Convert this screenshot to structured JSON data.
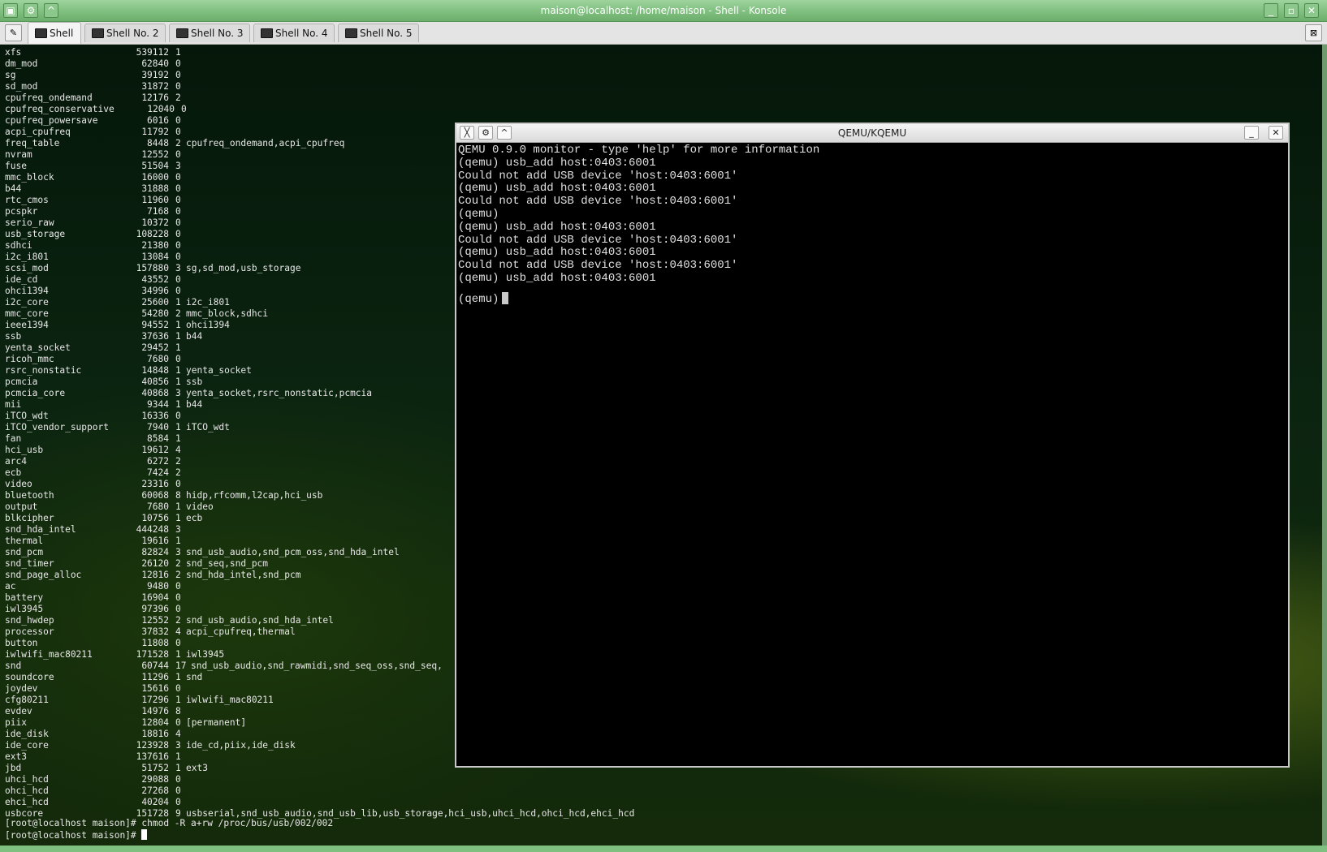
{
  "konsole": {
    "title": "maison@localhost: /home/maison - Shell - Konsole",
    "tabs": [
      "Shell",
      "Shell No. 2",
      "Shell No. 3",
      "Shell No. 4",
      "Shell No. 5"
    ],
    "active_tab": 0,
    "modules": [
      [
        "xfs",
        "539112",
        "1",
        ""
      ],
      [
        "dm_mod",
        "62840",
        "0",
        ""
      ],
      [
        "sg",
        "39192",
        "0",
        ""
      ],
      [
        "sd_mod",
        "31872",
        "0",
        ""
      ],
      [
        "cpufreq_ondemand",
        "12176",
        "2",
        ""
      ],
      [
        "cpufreq_conservative",
        "12040",
        "0",
        ""
      ],
      [
        "cpufreq_powersave",
        "6016",
        "0",
        ""
      ],
      [
        "acpi_cpufreq",
        "11792",
        "0",
        ""
      ],
      [
        "freq_table",
        "8448",
        "2",
        "cpufreq_ondemand,acpi_cpufreq"
      ],
      [
        "nvram",
        "12552",
        "0",
        ""
      ],
      [
        "fuse",
        "51504",
        "3",
        ""
      ],
      [
        "mmc_block",
        "16000",
        "0",
        ""
      ],
      [
        "b44",
        "31888",
        "0",
        ""
      ],
      [
        "rtc_cmos",
        "11960",
        "0",
        ""
      ],
      [
        "pcspkr",
        "7168",
        "0",
        ""
      ],
      [
        "serio_raw",
        "10372",
        "0",
        ""
      ],
      [
        "usb_storage",
        "108228",
        "0",
        ""
      ],
      [
        "sdhci",
        "21380",
        "0",
        ""
      ],
      [
        "i2c_i801",
        "13084",
        "0",
        ""
      ],
      [
        "scsi_mod",
        "157880",
        "3",
        "sg,sd_mod,usb_storage"
      ],
      [
        "ide_cd",
        "43552",
        "0",
        ""
      ],
      [
        "ohci1394",
        "34996",
        "0",
        ""
      ],
      [
        "i2c_core",
        "25600",
        "1",
        "i2c_i801"
      ],
      [
        "mmc_core",
        "54280",
        "2",
        "mmc_block,sdhci"
      ],
      [
        "ieee1394",
        "94552",
        "1",
        "ohci1394"
      ],
      [
        "ssb",
        "37636",
        "1",
        "b44"
      ],
      [
        "yenta_socket",
        "29452",
        "1",
        ""
      ],
      [
        "ricoh_mmc",
        "7680",
        "0",
        ""
      ],
      [
        "rsrc_nonstatic",
        "14848",
        "1",
        "yenta_socket"
      ],
      [
        "pcmcia",
        "40856",
        "1",
        "ssb"
      ],
      [
        "pcmcia_core",
        "40868",
        "3",
        "yenta_socket,rsrc_nonstatic,pcmcia"
      ],
      [
        "mii",
        "9344",
        "1",
        "b44"
      ],
      [
        "iTCO_wdt",
        "16336",
        "0",
        ""
      ],
      [
        "iTCO_vendor_support",
        "7940",
        "1",
        "iTCO_wdt"
      ],
      [
        "fan",
        "8584",
        "1",
        ""
      ],
      [
        "hci_usb",
        "19612",
        "4",
        ""
      ],
      [
        "arc4",
        "6272",
        "2",
        ""
      ],
      [
        "ecb",
        "7424",
        "2",
        ""
      ],
      [
        "video",
        "23316",
        "0",
        ""
      ],
      [
        "bluetooth",
        "60068",
        "8",
        "hidp,rfcomm,l2cap,hci_usb"
      ],
      [
        "output",
        "7680",
        "1",
        "video"
      ],
      [
        "blkcipher",
        "10756",
        "1",
        "ecb"
      ],
      [
        "snd_hda_intel",
        "444248",
        "3",
        ""
      ],
      [
        "thermal",
        "19616",
        "1",
        ""
      ],
      [
        "snd_pcm",
        "82824",
        "3",
        "snd_usb_audio,snd_pcm_oss,snd_hda_intel"
      ],
      [
        "snd_timer",
        "26120",
        "2",
        "snd_seq,snd_pcm"
      ],
      [
        "snd_page_alloc",
        "12816",
        "2",
        "snd_hda_intel,snd_pcm"
      ],
      [
        "ac",
        "9480",
        "0",
        ""
      ],
      [
        "battery",
        "16904",
        "0",
        ""
      ],
      [
        "iwl3945",
        "97396",
        "0",
        ""
      ],
      [
        "snd_hwdep",
        "12552",
        "2",
        "snd_usb_audio,snd_hda_intel"
      ],
      [
        "processor",
        "37832",
        "4",
        "acpi_cpufreq,thermal"
      ],
      [
        "button",
        "11808",
        "0",
        ""
      ],
      [
        "iwlwifi_mac80211",
        "171528",
        "1",
        "iwl3945"
      ],
      [
        "snd",
        "60744",
        "17",
        "snd_usb_audio,snd_rawmidi,snd_seq_oss,snd_seq,"
      ],
      [
        "soundcore",
        "11296",
        "1",
        "snd"
      ],
      [
        "joydev",
        "15616",
        "0",
        ""
      ],
      [
        "cfg80211",
        "17296",
        "1",
        "iwlwifi_mac80211"
      ],
      [
        "evdev",
        "14976",
        "8",
        ""
      ],
      [
        "piix",
        "12804",
        "0",
        "[permanent]"
      ],
      [
        "ide_disk",
        "18816",
        "4",
        ""
      ],
      [
        "ide_core",
        "123928",
        "3",
        "ide_cd,piix,ide_disk"
      ],
      [
        "ext3",
        "137616",
        "1",
        ""
      ],
      [
        "jbd",
        "51752",
        "1",
        "ext3"
      ],
      [
        "uhci_hcd",
        "29088",
        "0",
        ""
      ],
      [
        "ohci_hcd",
        "27268",
        "0",
        ""
      ],
      [
        "ehci_hcd",
        "40204",
        "0",
        ""
      ],
      [
        "usbcore",
        "151728",
        "9",
        "usbserial,snd_usb_audio,snd_usb_lib,usb_storage,hci_usb,uhci_hcd,ohci_hcd,ehci_hcd"
      ]
    ],
    "command_line": "[root@localhost maison]# chmod -R a+rw /proc/bus/usb/002/002",
    "prompt": "[root@localhost maison]# "
  },
  "qemu": {
    "title": "QEMU/KQEMU",
    "lines": [
      "QEMU 0.9.0 monitor - type 'help' for more information",
      "(qemu) usb_add host:0403:6001",
      "Could not add USB device 'host:0403:6001'",
      "(qemu) usb_add host:0403:6001",
      "Could not add USB device 'host:0403:6001'",
      "(qemu)",
      "(qemu) usb_add host:0403:6001",
      "Could not add USB device 'host:0403:6001'",
      "(qemu) usb_add host:0403:6001",
      "Could not add USB device 'host:0403:6001'",
      "(qemu) usb_add host:0403:6001"
    ],
    "prompt": "(qemu)"
  },
  "icons": {
    "konsole_menu": "konsole-app-icon",
    "sticky": "sticky-icon",
    "shade": "shade-up-icon",
    "minimize": "minimize-icon",
    "maximize": "maximize-icon",
    "close": "close-icon",
    "new_tab": "new-tab-icon",
    "close_tab": "close-tab-icon"
  }
}
